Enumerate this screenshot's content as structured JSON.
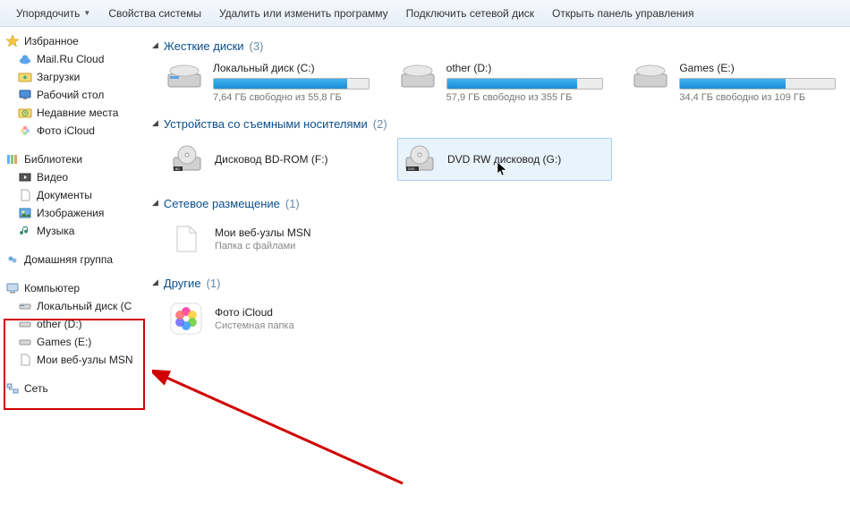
{
  "toolbar": {
    "organize": "Упорядочить",
    "properties": "Свойства системы",
    "uninstall": "Удалить или изменить программу",
    "map_drive": "Подключить сетевой диск",
    "control_panel": "Открыть панель управления"
  },
  "sidebar": {
    "favorites": {
      "header": "Избранное",
      "items": [
        "Mail.Ru Cloud",
        "Загрузки",
        "Рабочий стол",
        "Недавние места",
        "Фото iCloud"
      ]
    },
    "libraries": {
      "header": "Библиотеки",
      "items": [
        "Видео",
        "Документы",
        "Изображения",
        "Музыка"
      ]
    },
    "homegroup": "Домашняя группа",
    "computer": {
      "header": "Компьютер",
      "items": [
        "Локальный диск (C",
        "other (D:)",
        "Games (E:)",
        "Мои веб-узлы MSN"
      ]
    },
    "network": "Сеть"
  },
  "sections": {
    "hdd": {
      "title": "Жесткие диски",
      "count": "(3)"
    },
    "removable": {
      "title": "Устройства со съемными носителями",
      "count": "(2)"
    },
    "netloc": {
      "title": "Сетевое размещение",
      "count": "(1)"
    },
    "other": {
      "title": "Другие",
      "count": "(1)"
    }
  },
  "drives": [
    {
      "name": "Локальный диск (C:)",
      "status": "7,64 ГБ свободно из 55,8 ГБ",
      "fill_pct": 86
    },
    {
      "name": "other (D:)",
      "status": "57,9 ГБ свободно из 355 ГБ",
      "fill_pct": 84
    },
    {
      "name": "Games (E:)",
      "status": "34,4 ГБ свободно из 109 ГБ",
      "fill_pct": 68
    }
  ],
  "removable": {
    "bd": "Дисковод BD-ROM (F:)",
    "dvd": "DVD RW дисковод (G:)"
  },
  "netloc_item": {
    "name": "Мои веб-узлы MSN",
    "sub": "Папка с файлами"
  },
  "other_item": {
    "name": "Фото iCloud",
    "sub": "Системная папка"
  }
}
